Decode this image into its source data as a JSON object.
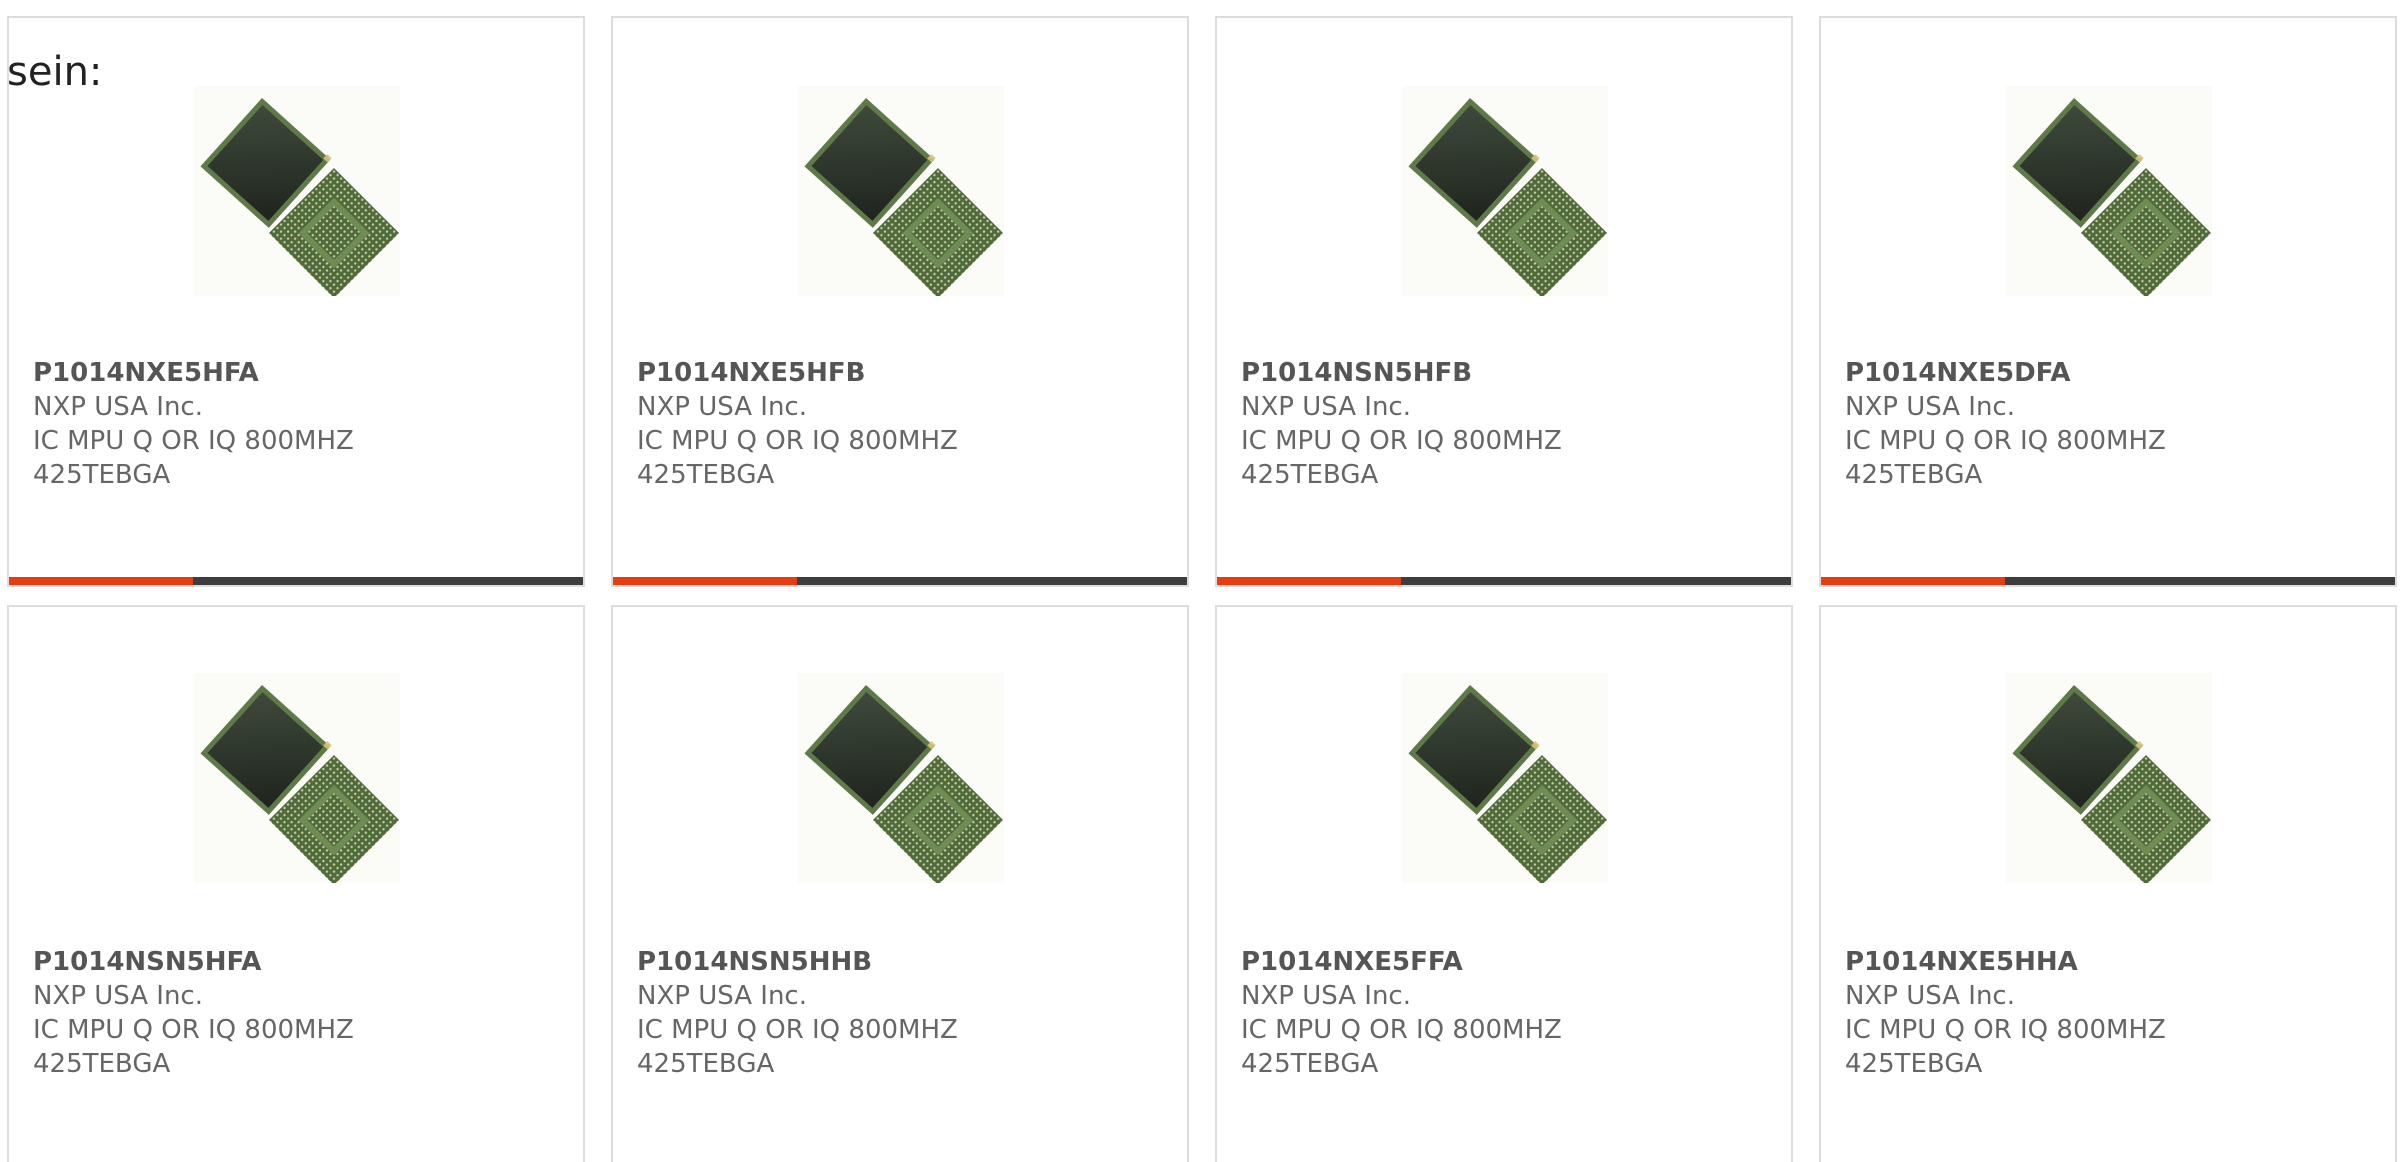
{
  "intro_text": "sein:",
  "colors": {
    "accent": "#e63c12",
    "bar_track": "#3d3d3d",
    "card_border": "#dddddd",
    "text_primary": "#555555",
    "text_secondary": "#666666"
  },
  "products": [
    {
      "part": "P1014NXE5HFA",
      "manufacturer": "NXP USA Inc.",
      "desc_line1": "IC MPU Q OR IQ 800MHZ",
      "desc_line2": "425TEBGA",
      "progress": 0.32
    },
    {
      "part": "P1014NXE5HFB",
      "manufacturer": "NXP USA Inc.",
      "desc_line1": "IC MPU Q OR IQ 800MHZ",
      "desc_line2": "425TEBGA",
      "progress": 0.32
    },
    {
      "part": "P1014NSN5HFB",
      "manufacturer": "NXP USA Inc.",
      "desc_line1": "IC MPU Q OR IQ 800MHZ",
      "desc_line2": "425TEBGA",
      "progress": 0.32
    },
    {
      "part": "P1014NXE5DFA",
      "manufacturer": "NXP USA Inc.",
      "desc_line1": "IC MPU Q OR IQ 800MHZ",
      "desc_line2": "425TEBGA",
      "progress": 0.32
    },
    {
      "part": "P1014NSN5HFA",
      "manufacturer": "NXP USA Inc.",
      "desc_line1": "IC MPU Q OR IQ 800MHZ",
      "desc_line2": "425TEBGA"
    },
    {
      "part": "P1014NSN5HHB",
      "manufacturer": "NXP USA Inc.",
      "desc_line1": "IC MPU Q OR IQ 800MHZ",
      "desc_line2": "425TEBGA"
    },
    {
      "part": "P1014NXE5FFA",
      "manufacturer": "NXP USA Inc.",
      "desc_line1": "IC MPU Q OR IQ 800MHZ",
      "desc_line2": "425TEBGA"
    },
    {
      "part": "P1014NXE5HHA",
      "manufacturer": "NXP USA Inc.",
      "desc_line1": "IC MPU Q OR IQ 800MHZ",
      "desc_line2": "425TEBGA"
    }
  ]
}
